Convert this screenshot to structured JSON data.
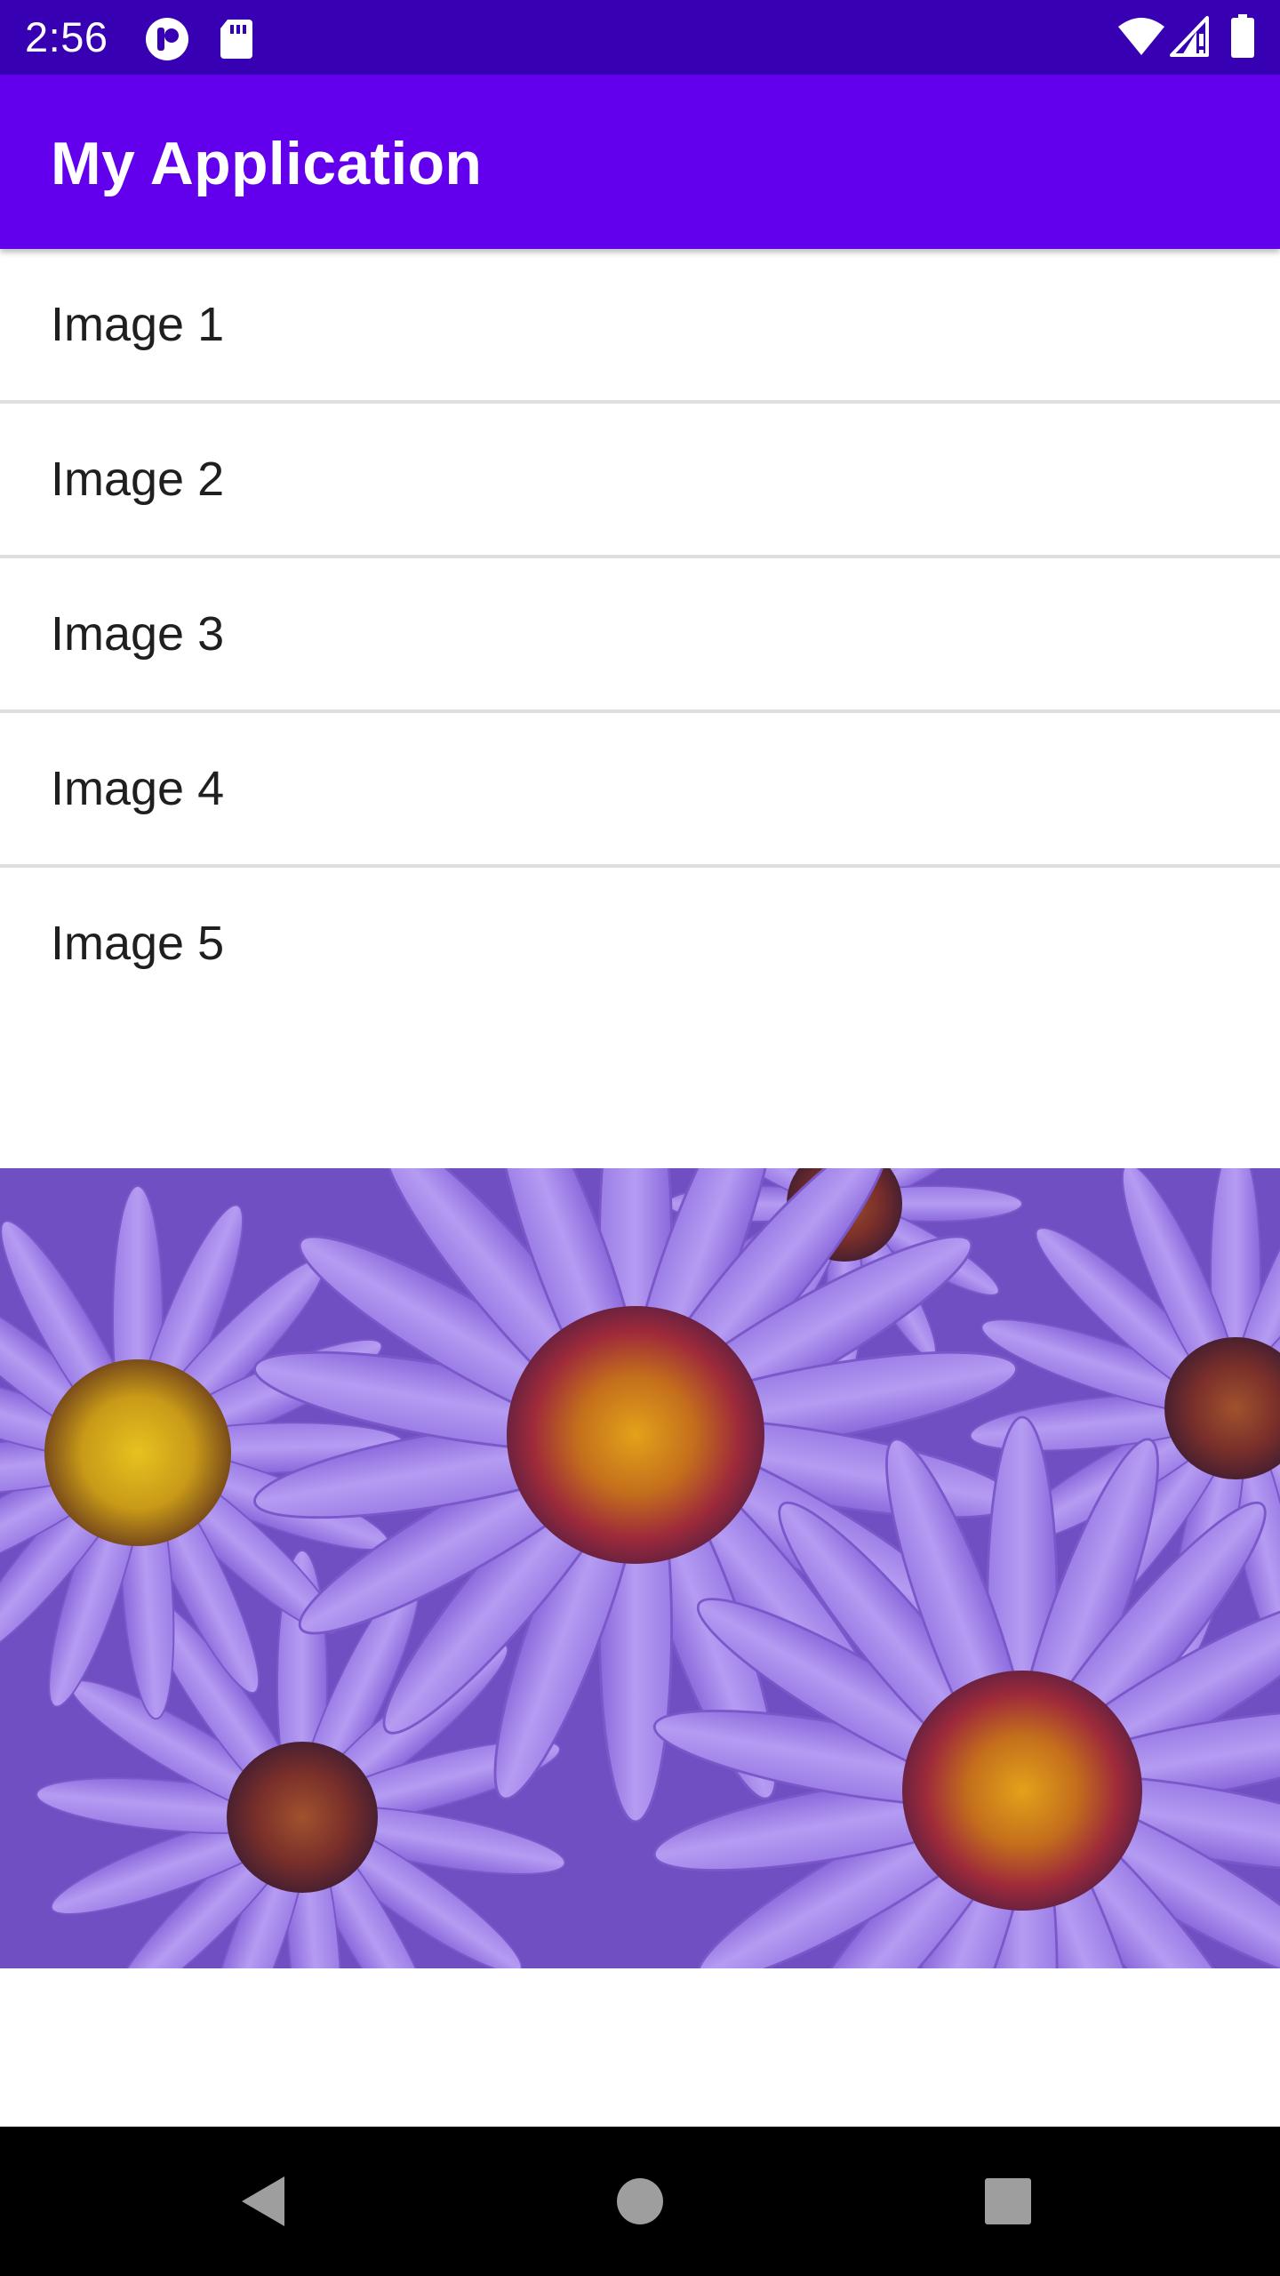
{
  "status_bar": {
    "time": "2:56",
    "icons": [
      "notification-app-icon",
      "sd-card-icon",
      "wifi-icon",
      "cell-signal-icon",
      "battery-icon"
    ]
  },
  "app_bar": {
    "title": "My Application",
    "color": "#6200ee"
  },
  "list": {
    "items": [
      {
        "label": "Image 1"
      },
      {
        "label": "Image 2"
      },
      {
        "label": "Image 3"
      },
      {
        "label": "Image 4"
      },
      {
        "label": "Image 5"
      }
    ]
  },
  "image": {
    "subject": "purple-aster-flowers"
  },
  "nav_bar": {
    "buttons": [
      "back-icon",
      "home-icon",
      "recents-icon"
    ]
  },
  "colors": {
    "status_bar": "#3700b3",
    "accent": "#6200ee",
    "text": "#1f1f1f",
    "divider": "#dedede"
  }
}
